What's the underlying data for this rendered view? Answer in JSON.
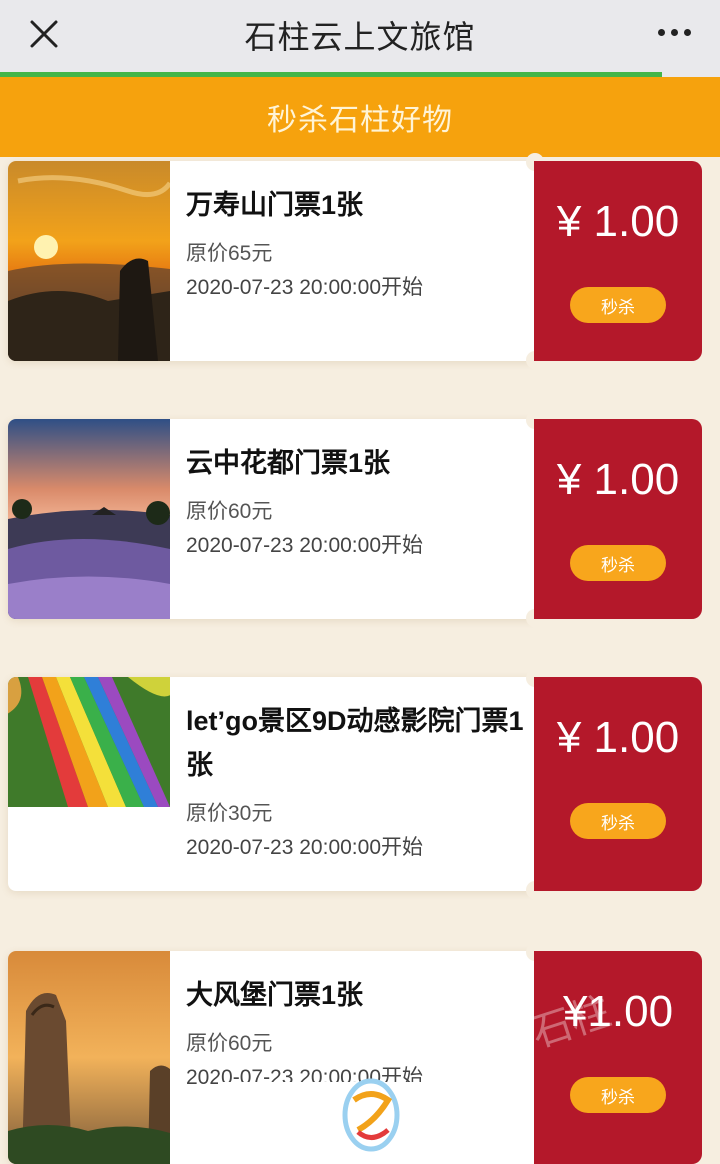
{
  "header": {
    "title": "石柱云上文旅馆",
    "close_icon": "close-icon",
    "more_icon": "more-icon",
    "progress_fraction": 0.92
  },
  "banner": {
    "text": "秒杀石柱好物"
  },
  "items": [
    {
      "title": "万寿山门票1张",
      "orig_price": "原价65元",
      "start_time": "2020-07-23 20:00:00开始",
      "price": "¥ 1.00",
      "button": "秒杀",
      "thumb": "sunset-mountain-photo"
    },
    {
      "title": "云中花都门票1张",
      "orig_price": "原价60元",
      "start_time": "2020-07-23 20:00:00开始",
      "price": "¥ 1.00",
      "button": "秒杀",
      "thumb": "lavender-field-photo"
    },
    {
      "title": "let’go景区9D动感影院门票1张",
      "orig_price": "原价30元",
      "start_time": "2020-07-23 20:00:00开始",
      "price": "¥ 1.00",
      "button": "秒杀",
      "thumb": "rainbow-slide-photo"
    },
    {
      "title": "大风堡门票1张",
      "orig_price": "原价60元",
      "start_time": "2020-07-23 20:00:00开始",
      "price": "¥1.00",
      "button": "秒杀",
      "thumb": "rock-pillar-photo"
    }
  ],
  "colors": {
    "banner": "#f6a20d",
    "price_panel": "#b4182a",
    "button": "#f8a61c",
    "progress": "#44b549"
  },
  "watermark": {
    "text": "石柱"
  }
}
